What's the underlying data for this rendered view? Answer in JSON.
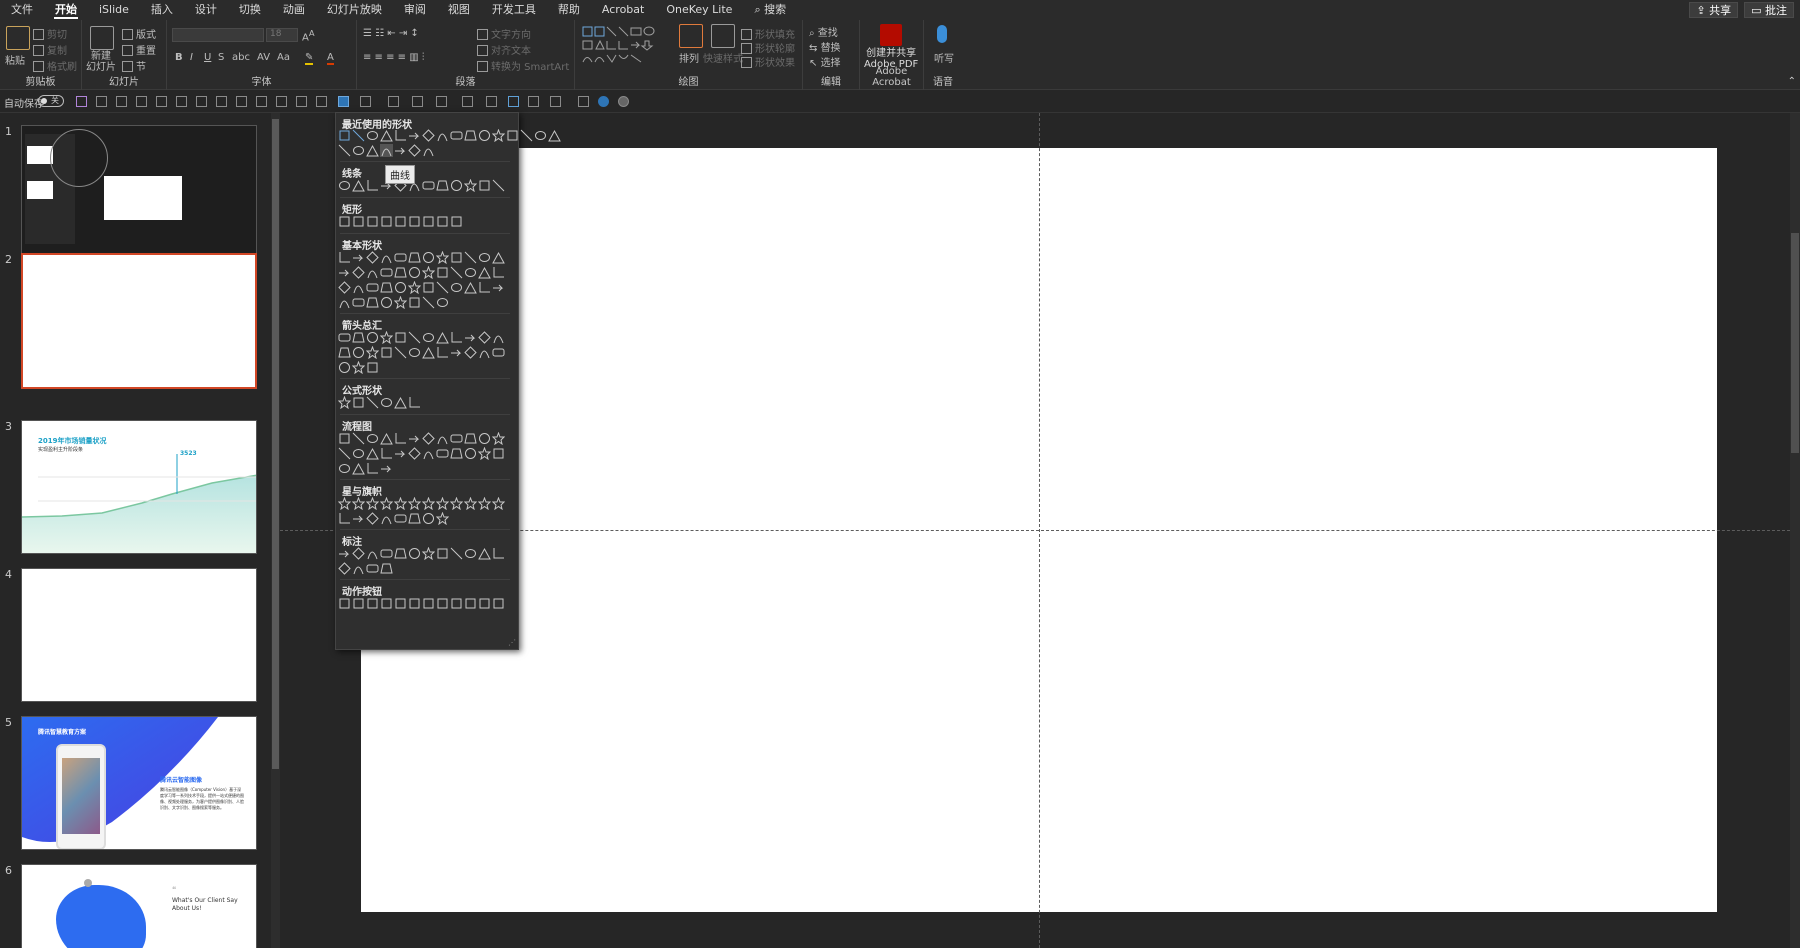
{
  "tabs": [
    "文件",
    "开始",
    "iSlide",
    "插入",
    "设计",
    "切换",
    "动画",
    "幻灯片放映",
    "审阅",
    "视图",
    "开发工具",
    "帮助",
    "Acrobat",
    "OneKey Lite",
    "搜索"
  ],
  "active_tab": "开始",
  "top_right": {
    "share": "共享",
    "comments": "批注"
  },
  "ribbon": {
    "clipboard": {
      "paste": "粘贴",
      "cut": "剪切",
      "copy": "复制",
      "format_painter": "格式刷",
      "label": "剪贴板"
    },
    "slides": {
      "new_slide": "新建\n幻灯片",
      "layout": "版式",
      "reset": "重置",
      "section": "节",
      "label": "幻灯片"
    },
    "font": {
      "font_name": "",
      "font_size": "18",
      "bold": "B",
      "italic": "I",
      "underline": "U",
      "strike": "S",
      "shadow": "abc",
      "spacing": "AV",
      "case": "Aa",
      "label": "字体"
    },
    "paragraph": {
      "text_direction": "文字方向",
      "align_text": "对齐文本",
      "smartart": "转换为 SmartArt",
      "label": "段落"
    },
    "drawing": {
      "arrange": "排列",
      "quick_styles": "快速样式",
      "shape_fill": "形状填充",
      "shape_outline": "形状轮廓",
      "shape_effects": "形状效果",
      "label": "绘图"
    },
    "editing": {
      "find": "查找",
      "replace": "替换",
      "select": "选择",
      "label": "编辑"
    },
    "acrobat": {
      "create": "创建并共享\nAdobe PDF",
      "label": "Adobe Acrobat"
    },
    "voice": {
      "dictate": "听写",
      "label": "语音"
    }
  },
  "qat": {
    "autosave": "自动保存",
    "autosave_state": "关"
  },
  "thumbnails": [
    {
      "num": "1"
    },
    {
      "num": "2",
      "selected": true
    },
    {
      "num": "3",
      "title": "2019年市场销量状况",
      "subtitle": "实现盈利主升阶段条",
      "value": "3523"
    },
    {
      "num": "4"
    },
    {
      "num": "5",
      "title": "腾讯智慧教育方案",
      "heading": "腾讯云智能图像",
      "body": "腾讯云智能图像（Computer Vision）基于深度学习等一系列技术手段，提供一站式便捷的图像、视频处理服务，为客户提供图像识别、人脸识别、文字识别、图像搜索等服务。"
    },
    {
      "num": "6",
      "title": "What's Our Client Say About Us!"
    }
  ],
  "shapes_panel": {
    "sections": [
      "最近使用的形状",
      "线条",
      "矩形",
      "基本形状",
      "箭头总汇",
      "公式形状",
      "流程图",
      "星与旗帜",
      "标注",
      "动作按钮"
    ],
    "tooltip": "曲线"
  },
  "colors": {
    "accent": "#d24726",
    "selected_shape": "#2e75b6"
  }
}
